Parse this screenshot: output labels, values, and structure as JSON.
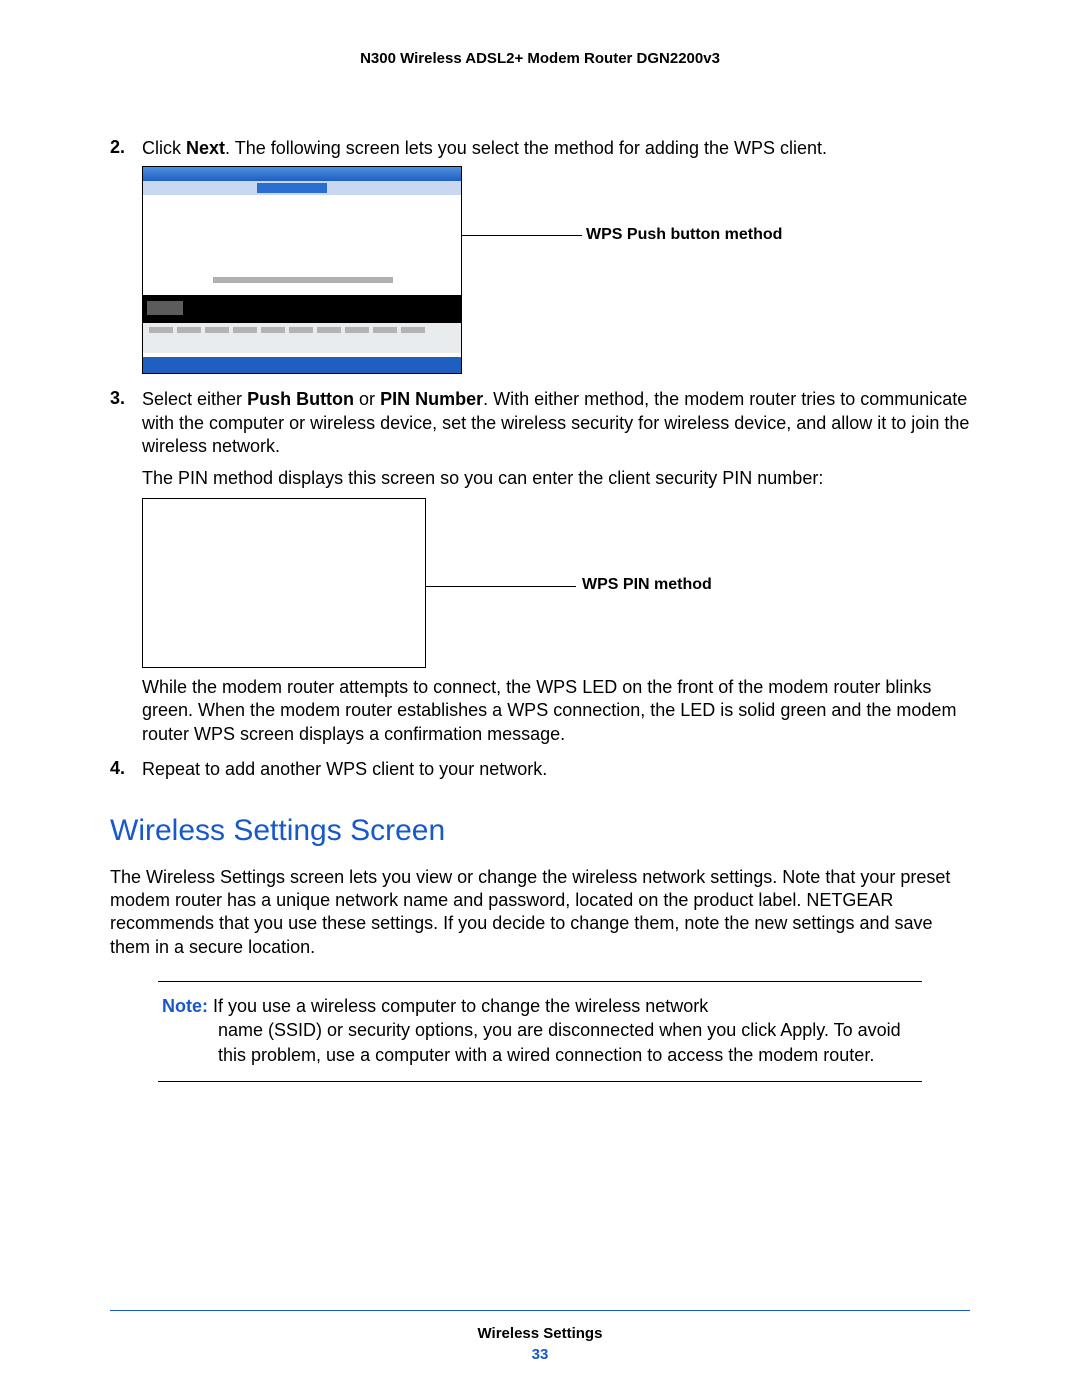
{
  "header": {
    "title": "N300 Wireless ADSL2+ Modem Router DGN2200v3"
  },
  "steps": {
    "s2": {
      "num": "2.",
      "pre": "Click ",
      "bold1": "Next",
      "post": ". The following screen lets you select the method for adding the WPS client."
    },
    "callout1": "WPS Push button method",
    "s3": {
      "num": "3.",
      "pre": "Select either ",
      "bold1": "Push Button",
      "mid": " or ",
      "bold2": "PIN Number",
      "post": ". With either method, the modem router tries to communicate with the computer or wireless device, set the wireless security for wireless device, and allow it to join the wireless network."
    },
    "s3_extra": "The PIN method displays this screen so you can enter the client security PIN number:",
    "callout2": "WPS PIN method",
    "s3_after": "While the modem router attempts to connect, the WPS LED on the front of the modem router blinks green. When the modem router establishes a WPS connection, the LED is solid green and the modem router WPS screen displays a confirmation message.",
    "s4": {
      "num": "4.",
      "text": "Repeat to add another WPS client to your network."
    }
  },
  "section": {
    "title": "Wireless Settings Screen",
    "para": "The Wireless Settings screen lets you view or change the wireless network settings. Note that your preset modem router has a unique network name and password, located on the product label. NETGEAR recommends that you use these settings. If you decide to change them, note the new settings and save them in a secure location."
  },
  "note": {
    "label": "Note:",
    "line1": "  If you use a wireless computer to change the wireless network",
    "rest": "name (SSID) or security options, you are disconnected when you click Apply. To avoid this problem, use a computer with a wired connection to access the modem router."
  },
  "footer": {
    "label": "Wireless Settings",
    "page": "33"
  }
}
